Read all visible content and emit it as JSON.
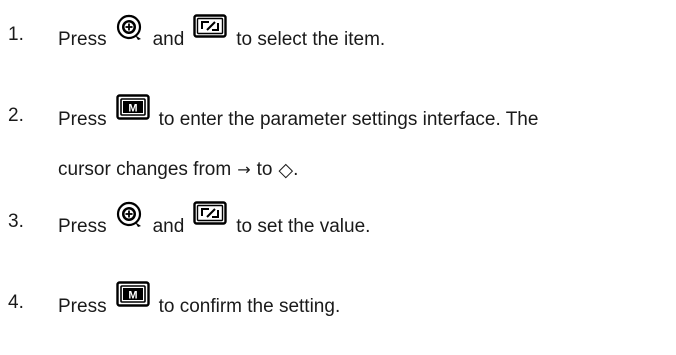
{
  "steps": [
    {
      "number": "1.",
      "press": "Press",
      "and": "and",
      "rest": "to select the item.",
      "icons": [
        "knob-icon",
        "back-icon"
      ]
    },
    {
      "number": "2.",
      "press": "Press",
      "rest": "to enter the parameter settings interface. The",
      "line2_a": "cursor changes from",
      "arrow": "→",
      "to": "to",
      "diamond": "◇",
      "period": ".",
      "icons": [
        "menu-m-icon"
      ]
    },
    {
      "number": "3.",
      "press": "Press",
      "and": "and",
      "rest": "to set the value.",
      "icons": [
        "knob-icon",
        "back-icon"
      ]
    },
    {
      "number": "4.",
      "press": "Press",
      "rest": "to confirm the setting.",
      "icons": [
        "menu-m-icon"
      ]
    }
  ],
  "icon_letters": {
    "menu_key": "M"
  }
}
